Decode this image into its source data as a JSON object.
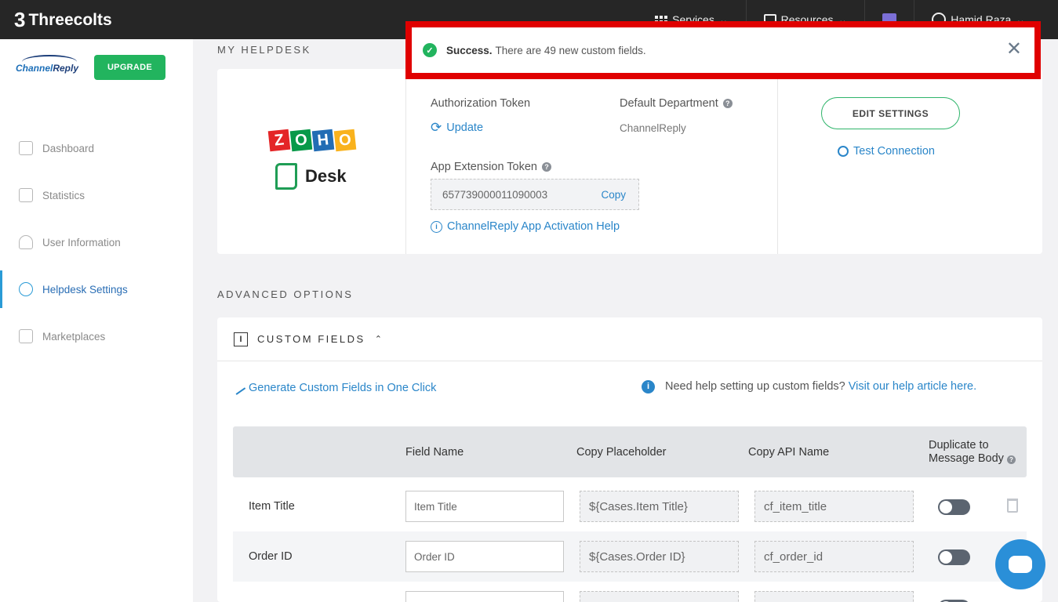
{
  "topbar": {
    "brand": "Threecolts",
    "brand_mark": "3",
    "services": "Services",
    "resources": "Resources",
    "user_name": "Hamid Raza",
    "caret": "⌄"
  },
  "sidebar": {
    "logo_text_a": "Channel",
    "logo_text_b": "Reply",
    "upgrade": "UPGRADE",
    "items": [
      {
        "label": "Dashboard"
      },
      {
        "label": "Statistics"
      },
      {
        "label": "User Information"
      },
      {
        "label": "Helpdesk Settings"
      },
      {
        "label": "Marketplaces"
      }
    ]
  },
  "helpdesk": {
    "section_title": "MY HELPDESK",
    "logo_letters": [
      "Z",
      "O",
      "H",
      "O"
    ],
    "logo_colors": [
      "#e42527",
      "#089949",
      "#226db4",
      "#f9b21d"
    ],
    "desk_label": "Desk",
    "auth_token_label": "Authorization Token",
    "update_label": "Update",
    "default_dept_label": "Default Department",
    "default_dept_value": "ChannelReply",
    "app_ext_token_label": "App Extension Token",
    "app_ext_token_value": "657739000011090003",
    "copy_label": "Copy",
    "activation_help": "ChannelReply App Activation Help",
    "edit_settings": "EDIT SETTINGS",
    "test_connection": "Test Connection"
  },
  "toast": {
    "title": "Success.",
    "message": "There are 49 new custom fields.",
    "close": "✕",
    "check": "✓"
  },
  "advanced": {
    "section_title": "ADVANCED OPTIONS",
    "custom_fields_title": "CUSTOM FIELDS",
    "collapse_glyph": "⌃",
    "generate_link": "Generate Custom Fields in One Click",
    "help_text": "Need help setting up custom fields?",
    "help_link": "Visit our help article here.",
    "table": {
      "headers": {
        "field_name": "Field Name",
        "copy_placeholder": "Copy Placeholder",
        "copy_api": "Copy API Name",
        "duplicate_line1": "Duplicate to",
        "duplicate_line2": "Message Body"
      },
      "rows": [
        {
          "name": "Item Title",
          "placeholder": "Item Title",
          "ph": "${Cases.Item Title}",
          "api": "cf_item_title",
          "duplicate": false
        },
        {
          "name": "Order ID",
          "placeholder": "Order ID",
          "ph": "${Cases.Order ID}",
          "api": "cf_order_id",
          "duplicate": false
        }
      ]
    }
  }
}
